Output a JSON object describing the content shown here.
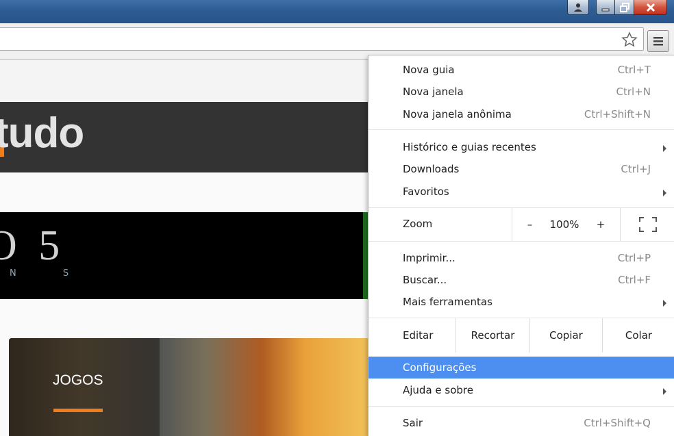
{
  "window": {
    "controls": [
      "user-icon",
      "minimize-icon",
      "maximize-icon",
      "close-icon"
    ]
  },
  "toolbar": {
    "star_icon": "star-icon",
    "menu_icon": "hamburger-icon"
  },
  "page": {
    "logo_text": "tudo",
    "banner_title": "O 5",
    "banner_subtitle": "N S",
    "card_label": "JOGOS"
  },
  "menu": {
    "items": [
      {
        "label": "Nova guia",
        "shortcut": "Ctrl+T"
      },
      {
        "label": "Nova janela",
        "shortcut": "Ctrl+N"
      },
      {
        "label": "Nova janela anônima",
        "shortcut": "Ctrl+Shift+N"
      },
      {
        "label": "Histórico e guias recentes",
        "shortcut": ""
      },
      {
        "label": "Downloads",
        "shortcut": "Ctrl+J"
      },
      {
        "label": "Favoritos",
        "shortcut": ""
      },
      {
        "label": "Imprimir...",
        "shortcut": "Ctrl+P"
      },
      {
        "label": "Buscar...",
        "shortcut": "Ctrl+F"
      },
      {
        "label": "Mais ferramentas",
        "shortcut": ""
      },
      {
        "label": "Configurações",
        "shortcut": ""
      },
      {
        "label": "Ajuda e sobre",
        "shortcut": ""
      },
      {
        "label": "Sair",
        "shortcut": "Ctrl+Shift+Q"
      }
    ],
    "zoom": {
      "label": "Zoom",
      "minus": "–",
      "value": "100%",
      "plus": "+"
    },
    "edit": {
      "label": "Editar",
      "cut": "Recortar",
      "copy": "Copiar",
      "paste": "Colar"
    },
    "highlight_color": "#4c8ff0"
  },
  "colors": {
    "accent_orange": "#f07d19",
    "title_bar": "#2d5c93"
  }
}
